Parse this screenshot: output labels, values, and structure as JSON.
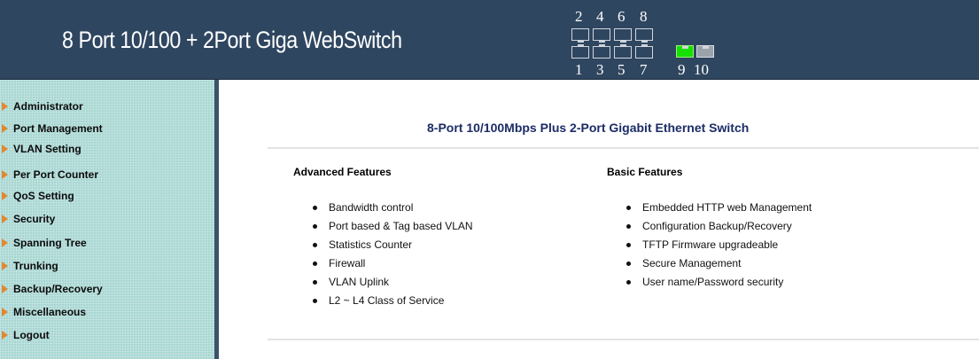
{
  "header": {
    "title": "8 Port 10/100 + 2Port Giga WebSwitch",
    "ports_top": [
      "2",
      "4",
      "6",
      "8"
    ],
    "ports_bottom": [
      "1",
      "3",
      "5",
      "7"
    ],
    "giga_ports": [
      "9",
      "10"
    ],
    "giga_active": "9",
    "active_color": "#16e000"
  },
  "sidebar": {
    "items": [
      {
        "label": "Administrator"
      },
      {
        "label": "Port Management"
      },
      {
        "label": "VLAN Setting"
      },
      {
        "label": "Per Port Counter"
      },
      {
        "label": "QoS Setting"
      },
      {
        "label": "Security"
      },
      {
        "label": "Spanning Tree"
      },
      {
        "label": "Trunking"
      },
      {
        "label": "Backup/Recovery"
      },
      {
        "label": "Miscellaneous"
      },
      {
        "label": "Logout"
      }
    ],
    "arrow_icon": "arrow-right-icon",
    "arrow_color": "#e08830"
  },
  "main": {
    "title": "8-Port 10/100Mbps Plus 2-Port Gigabit Ethernet Switch",
    "advanced": {
      "heading": "Advanced Features",
      "items": [
        "Bandwidth control",
        "Port based & Tag based VLAN",
        "Statistics Counter",
        "Firewall",
        "VLAN Uplink",
        "L2 ~ L4 Class of Service"
      ]
    },
    "basic": {
      "heading": "Basic Features",
      "items": [
        "Embedded HTTP web Management",
        "Configuration Backup/Recovery",
        "TFTP Firmware upgradeable",
        "Secure Management",
        "User name/Password security"
      ]
    }
  }
}
